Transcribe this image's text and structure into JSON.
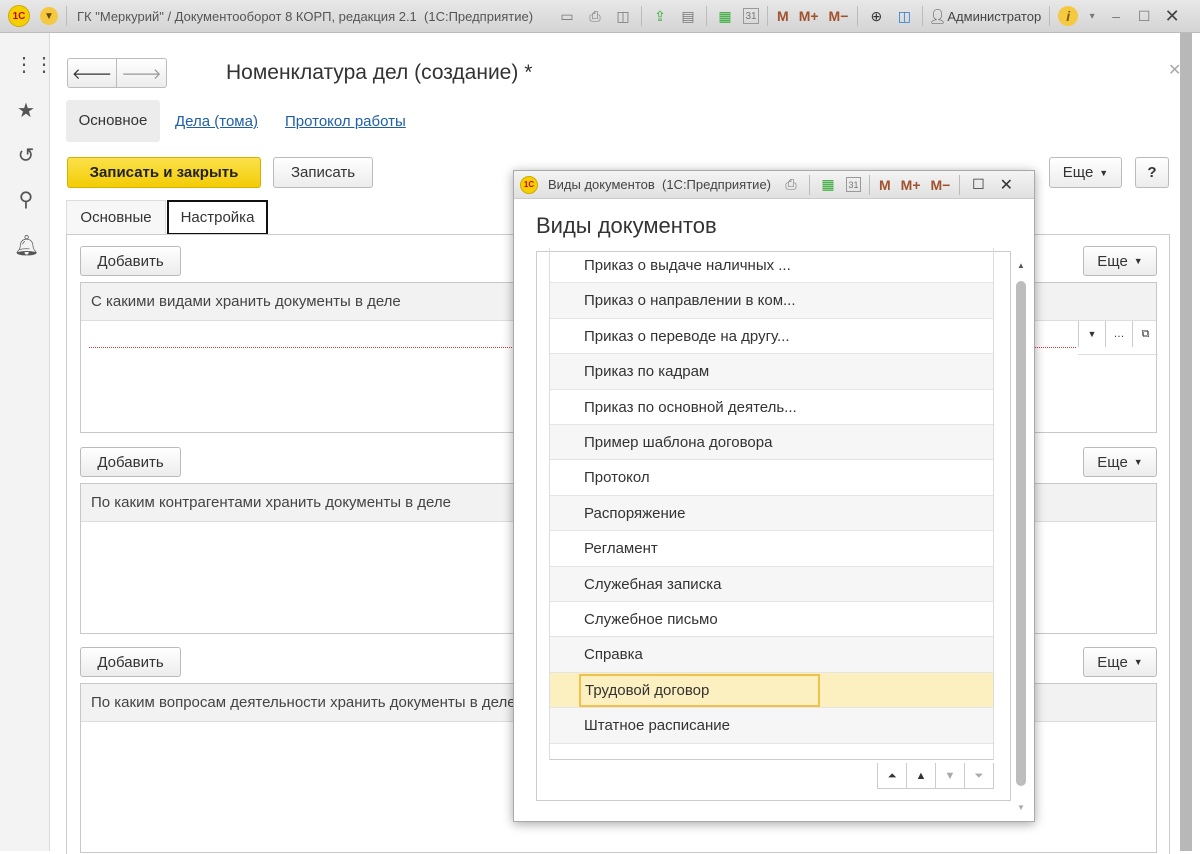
{
  "app": {
    "title": "ГК \"Меркурий\" / Документооборот 8 КОРП, редакция 2.1  (1С:Предприятие)",
    "user": "Администратор",
    "logo_text": "1С",
    "toolbar_icons": [
      "save-icon",
      "print-icon",
      "preview-icon",
      "link-icon",
      "scan-icon",
      "calculator-icon",
      "calendar-icon",
      "m-icon",
      "m-plus-icon",
      "m-minus-icon",
      "zoom-icon",
      "panel-icon",
      "info-icon"
    ],
    "memory_labels": [
      "M",
      "M+",
      "M−"
    ]
  },
  "sidebar": {
    "icons": [
      "apps-grid-icon",
      "star-icon",
      "history-icon",
      "search-icon",
      "bell-icon"
    ]
  },
  "form": {
    "title": "Номенклатура дел (создание) *",
    "tabs": [
      {
        "label": "Основное",
        "active": true
      },
      {
        "label": "Дела (тома)"
      },
      {
        "label": "Протокол работы"
      }
    ],
    "save_close": "Записать и закрыть",
    "save": "Записать",
    "more": "Еще",
    "help": "?",
    "subtabs": [
      {
        "label": "Основные"
      },
      {
        "label": "Настройка",
        "active": true
      }
    ],
    "sections": [
      {
        "add": "Добавить",
        "more": "Еще",
        "header": "С какими видами хранить документы в деле"
      },
      {
        "add": "Добавить",
        "more": "Еще",
        "header": "По каким контрагентами хранить документы в деле"
      },
      {
        "add": "Добавить",
        "more": "Еще",
        "header": "По каким вопросам деятельности хранить документы в деле"
      }
    ]
  },
  "popup": {
    "window_title": "Виды документов  (1С:Предприятие)",
    "heading": "Виды документов",
    "items": [
      "Приказ о выдаче наличных ...",
      "Приказ о направлении в ком...",
      "Приказ о переводе на другу...",
      "Приказ по кадрам",
      "Приказ по основной деятель...",
      "Пример шаблона договора",
      "Протокол",
      "Распоряжение",
      "Регламент",
      "Служебная записка",
      "Служебное письмо",
      "Справка",
      "Трудовой договор",
      "Штатное расписание"
    ],
    "selected": "Трудовой договор"
  },
  "colors": {
    "accent_yellow": "#f8d516",
    "link": "#1f5fa8",
    "selection": "#fcefc0"
  }
}
